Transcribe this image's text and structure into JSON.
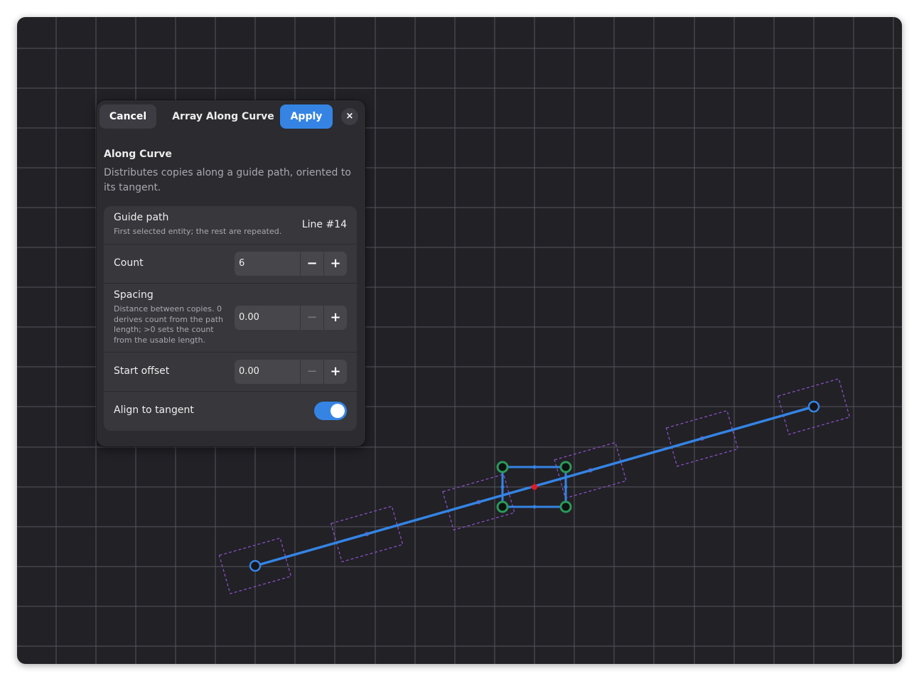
{
  "header": {
    "cancel_label": "Cancel",
    "title": "Array Along Curve",
    "apply_label": "Apply",
    "close_icon": "×"
  },
  "section": {
    "title": "Along Curve",
    "description": "Distributes copies along a guide path, oriented to its tangent."
  },
  "settings": {
    "guide_path": {
      "label": "Guide path",
      "sublabel": "First selected entity; the rest are repeated.",
      "value": "Line #14"
    },
    "count": {
      "label": "Count",
      "value": "6",
      "minus": "−",
      "plus": "+"
    },
    "spacing": {
      "label": "Spacing",
      "sublabel": "Distance between copies. 0 derives count from the path length; >0 sets the count from the usable length.",
      "value": "0.00",
      "minus": "−",
      "plus": "+"
    },
    "start_offset": {
      "label": "Start offset",
      "value": "0.00",
      "minus": "−",
      "plus": "+"
    },
    "align_to_tangent": {
      "label": "Align to tangent",
      "enabled": true
    }
  },
  "colors": {
    "accent": "#3584e4",
    "grid": "#55555c",
    "preview_copy": "#8a4fc0",
    "selection_handle": "#2a9a5a",
    "pivot": "#e01b24"
  }
}
